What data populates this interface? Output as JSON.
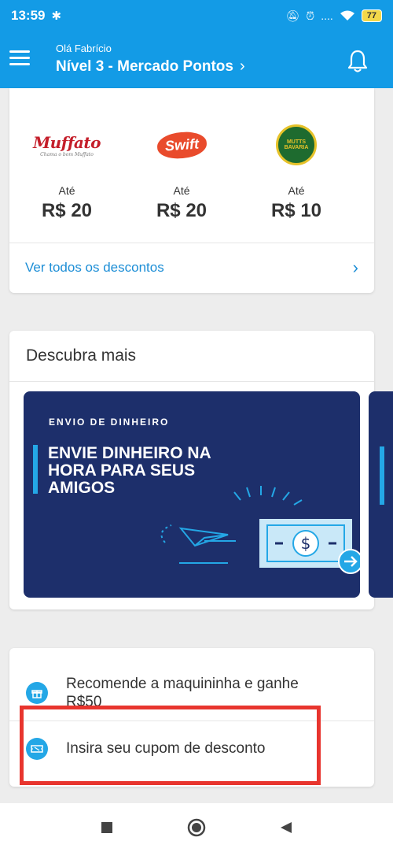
{
  "status": {
    "time": "13:59",
    "signal": "....",
    "battery": "77"
  },
  "header": {
    "greeting": "Olá Fabrício",
    "level": "Nível 3 - Mercado Pontos"
  },
  "discounts": {
    "stores": [
      {
        "logo_text": "Muffato",
        "logo_sub": "Chama o bom Muffato",
        "prefix": "Até",
        "amount": "R$ 20"
      },
      {
        "logo_text": "Swift",
        "prefix": "Até",
        "amount": "R$ 20"
      },
      {
        "logo_text": "MUTTS BAVARIA",
        "prefix": "Até",
        "amount": "R$ 10"
      }
    ],
    "see_all": "Ver todos os descontos"
  },
  "discover": {
    "title": "Descubra mais",
    "banner": {
      "kicker": "ENVIO DE DINHEIRO",
      "headline": "ENVIE DINHEIRO NA HORA PARA SEUS AMIGOS"
    }
  },
  "actions": [
    {
      "label": "Recomende a maquininha e ganhe R$50",
      "icon": "gift-icon"
    },
    {
      "label": "Insira seu cupom de desconto",
      "icon": "ticket-icon"
    }
  ],
  "colors": {
    "primary": "#139be6",
    "banner": "#1d2f6b",
    "accent": "#24a7e6",
    "highlight": "#e8352e"
  }
}
